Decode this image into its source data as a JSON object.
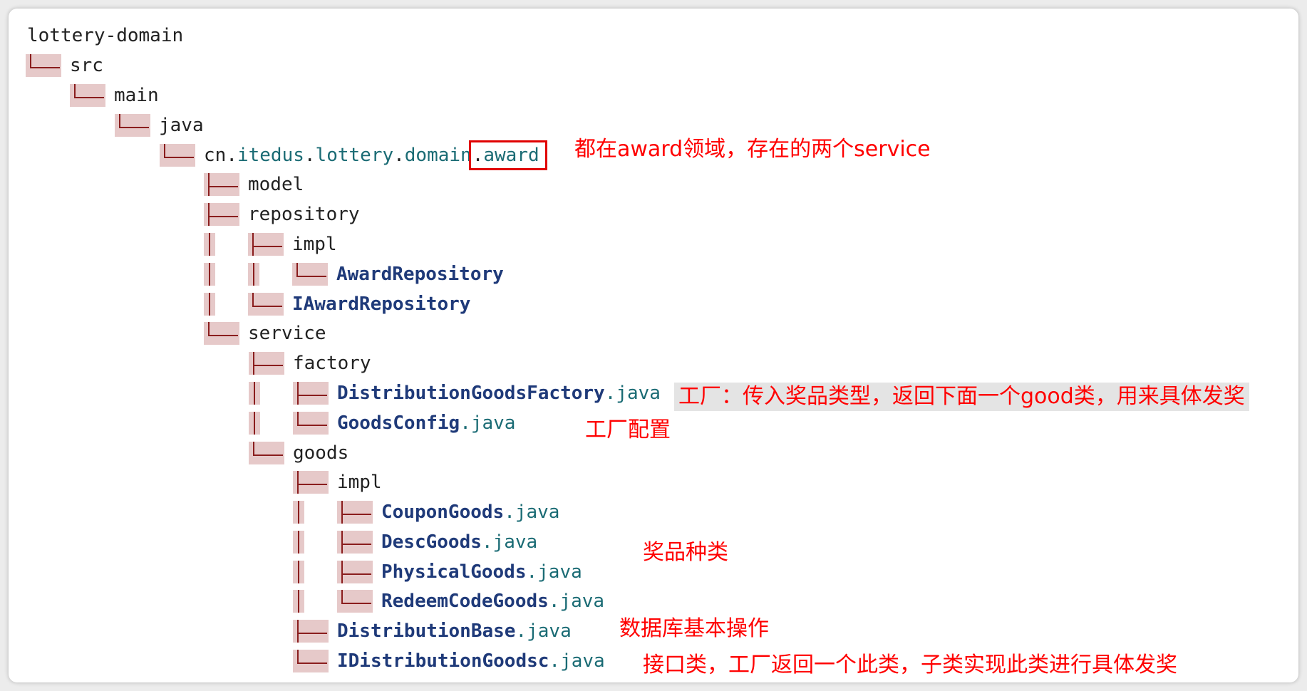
{
  "tree": {
    "root": "lottery-domain",
    "src": "src",
    "main": "main",
    "java": "java",
    "package": {
      "p1": "cn",
      "p2": "itedus",
      "p3": "lottery",
      "p4": "domain",
      "dot": ".",
      "award": "award"
    },
    "model": "model",
    "repository": "repository",
    "repo_impl": "impl",
    "award_repository": "AwardRepository",
    "iaward_repository": "IAwardRepository",
    "service": "service",
    "factory": "factory",
    "distribution_goods_factory": "DistributionGoodsFactory",
    "goods_config": "GoodsConfig",
    "goods": "goods",
    "goods_impl": "impl",
    "coupon_goods": "CouponGoods",
    "desc_goods": "DescGoods",
    "physical_goods": "PhysicalGoods",
    "redeem_code_goods": "RedeemCodeGoods",
    "distribution_base": "DistributionBase",
    "idistribution_goodsc": "IDistributionGoodsc",
    "java_ext": ".java"
  },
  "notes": {
    "award_domain": "都在award领域，存在的两个service",
    "factory": "工厂：传入奖品类型，返回下面一个good类，用来具体发奖",
    "goods_config": "工厂配置",
    "goods_types": "奖品种类",
    "distribution_base": "数据库基本操作",
    "interface": "接口类，工厂返回一个此类，子类实现此类进行具体发奖"
  },
  "colors": {
    "annotation": "#ff0000",
    "highlight_box": "#e00000",
    "tree_line": "#8a1d1d",
    "tree_line_bg": "#e6c9c9",
    "class_name": "#1f3a79",
    "extension": "#1a6b74"
  }
}
